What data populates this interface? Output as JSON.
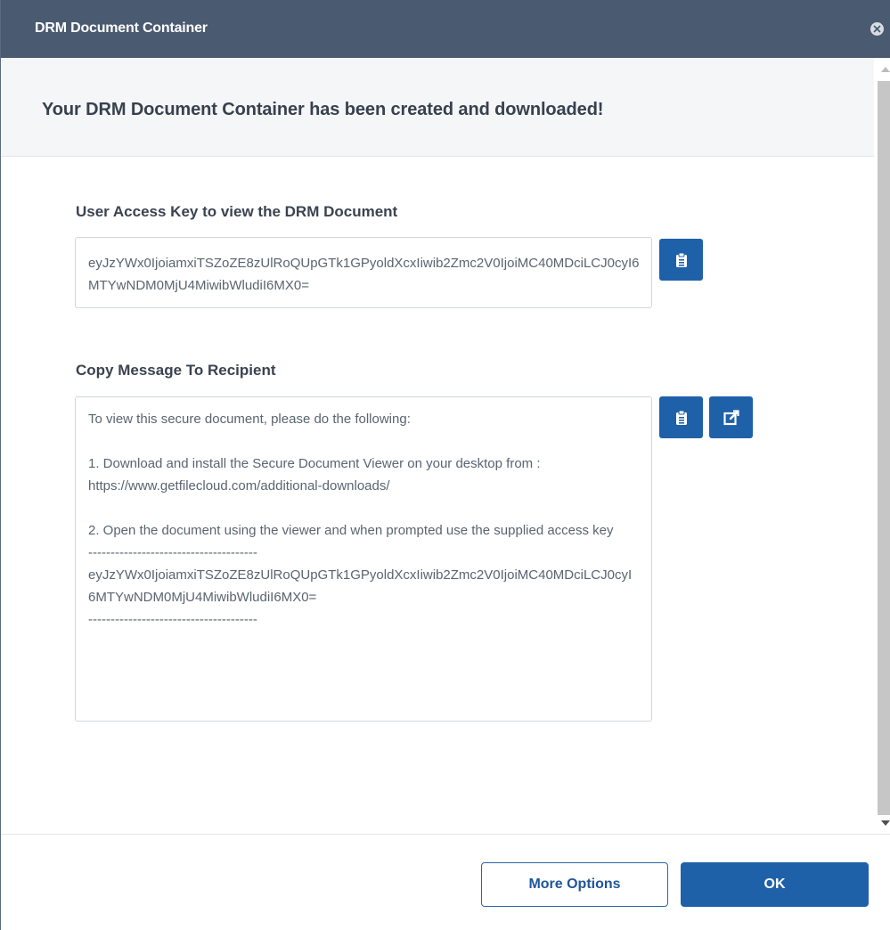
{
  "dialog": {
    "title": "DRM Document Container",
    "close_icon": "close-circle-icon",
    "heading": "Your DRM Document Container has been created and downloaded!"
  },
  "access_key": {
    "label": "User Access Key to view the DRM Document",
    "value": "eyJzYWx0IjoiamxiTSZoZE8zUlRoQUpGTk1GPyoldXcxIiwib2Zmc2V0IjoiMC40MDciLCJ0cyI6MTYwNDM0MjU4MiwibWludiI6MX0=",
    "copy_icon": "clipboard-icon"
  },
  "message": {
    "label": "Copy Message To Recipient",
    "text": "To view this secure document, please do the following:\n\n1. Download and install the Secure Document Viewer on your desktop from :\nhttps://www.getfilecloud.com/additional-downloads/\n\n2. Open the document using the viewer and when prompted use the supplied access key\n--------------------------------------\neyJzYWx0IjoiamxiTSZoZE8zUlRoQUpGTk1GPyoldXcxIiwib2Zmc2V0IjoiMC40MDciLCJ0cyI6MTYwNDM0MjU4MiwibWludiI6MX0=\n--------------------------------------",
    "copy_icon": "clipboard-icon",
    "open_icon": "external-edit-icon"
  },
  "footer": {
    "more_options_label": "More Options",
    "ok_label": "OK"
  },
  "colors": {
    "titlebar": "#4a5a70",
    "primary": "#1f61a8",
    "header_band": "#f5f6f8"
  }
}
